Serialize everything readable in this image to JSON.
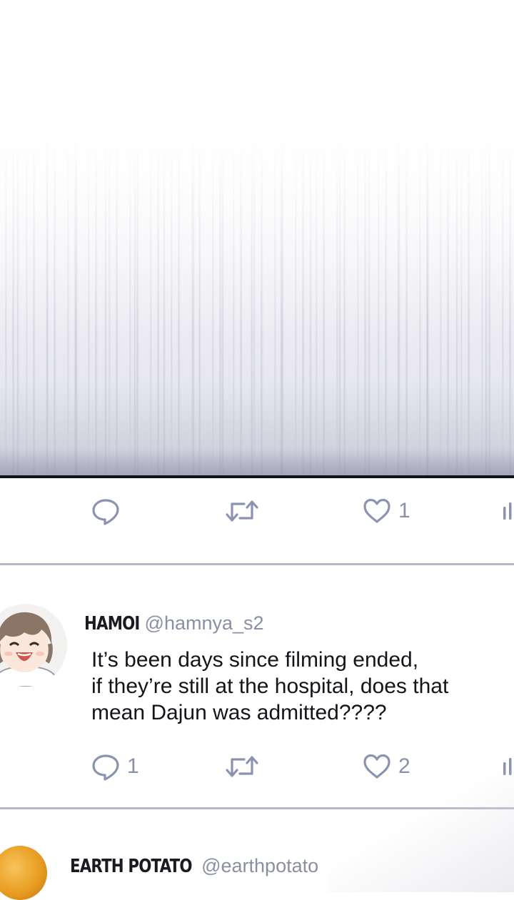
{
  "post1": {
    "actions": {
      "reply_count": "",
      "retweet_count": "",
      "like_count": "1"
    }
  },
  "post2": {
    "display_name": "HAMOI",
    "handle": "@hamnya_s2",
    "text_lines": [
      "It’s been days since filming ended,",
      "if they’re still at the hospital, does that",
      "mean Dajun was admitted????"
    ],
    "actions": {
      "reply_count": "1",
      "retweet_count": "",
      "like_count": "2"
    }
  },
  "post3": {
    "display_name": "EARTH POTATO",
    "handle": "@earthpotato"
  },
  "colors": {
    "icon": "#8b93b0",
    "divider": "#b3b8c6",
    "panel_border": "#111116",
    "text": "#14141a"
  },
  "icons": [
    "reply-icon",
    "retweet-icon",
    "like-icon",
    "stats-icon"
  ]
}
